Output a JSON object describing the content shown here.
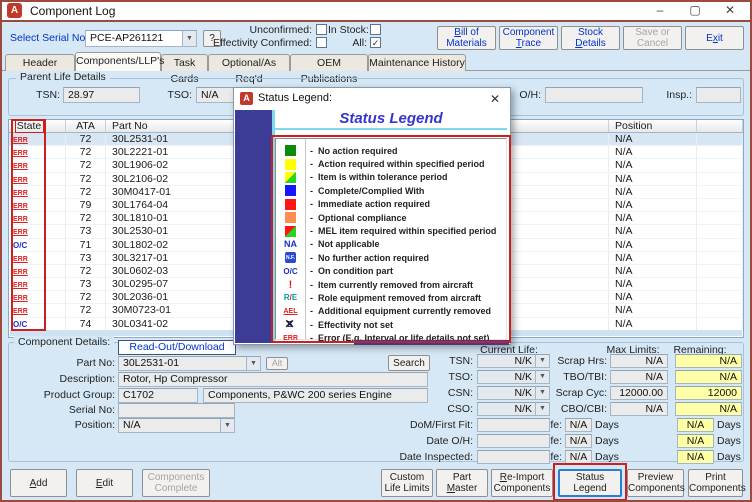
{
  "window": {
    "title": "Component Log",
    "app_icon_letter": "A",
    "controls": [
      {
        "name": "minimize",
        "glyph": "–"
      },
      {
        "name": "maximize",
        "glyph": "▢"
      },
      {
        "name": "close",
        "glyph": "✕"
      }
    ]
  },
  "header": {
    "serial_label": "Select Serial No:",
    "serial_value": "PCE-AP261121",
    "help_label": "?",
    "checkboxes": [
      {
        "label": "Unconfirmed:",
        "checked": false
      },
      {
        "label": "Effectivity Confirmed:",
        "checked": false
      },
      {
        "label": "In Stock:",
        "checked": false
      },
      {
        "label": "All:",
        "checked": true
      }
    ],
    "buttons": [
      {
        "lines": [
          "Bill of",
          "Materials"
        ],
        "accel": "B",
        "disabled": false
      },
      {
        "lines": [
          "Component",
          "Trace"
        ],
        "accel": "T",
        "disabled": false
      },
      {
        "lines": [
          "Stock",
          "Details"
        ],
        "accel": "D",
        "disabled": false
      },
      {
        "lines": [
          "Save or",
          "Cancel"
        ],
        "accel": null,
        "disabled": true
      },
      {
        "lines": [
          "Exit"
        ],
        "accel": "x",
        "disabled": false
      }
    ]
  },
  "tabs": [
    {
      "label": "Header Details",
      "active": false
    },
    {
      "label": "Components/LLP's",
      "active": true
    },
    {
      "label": "Task Cards",
      "active": false
    },
    {
      "label": "Optional/As Req'd",
      "active": false
    },
    {
      "label": "OEM Publications",
      "active": false
    },
    {
      "label": "Maintenance History",
      "active": false
    }
  ],
  "parent_life": {
    "title": "Parent Life Details",
    "fields": [
      {
        "label": "TSN:",
        "value": "28.97"
      },
      {
        "label": "TSO:",
        "value": "N/A"
      },
      {
        "label": "O/H:",
        "value": ""
      },
      {
        "label": "Insp.:",
        "value": ""
      }
    ]
  },
  "table": {
    "columns": [
      "State",
      "",
      "ATA",
      "Part No",
      "Position",
      ""
    ],
    "rows": [
      {
        "state": "ERR",
        "ata": "72",
        "part_no": "30L2531-01",
        "position": "N/A",
        "selected": true
      },
      {
        "state": "ERR",
        "ata": "72",
        "part_no": "30L2221-01",
        "position": "N/A",
        "selected": false
      },
      {
        "state": "ERR",
        "ata": "72",
        "part_no": "30L1906-02",
        "position": "N/A",
        "selected": false
      },
      {
        "state": "ERR",
        "ata": "72",
        "part_no": "30L2106-02",
        "position": "N/A",
        "selected": false
      },
      {
        "state": "ERR",
        "ata": "72",
        "part_no": "30M0417-01",
        "position": "N/A",
        "selected": false
      },
      {
        "state": "ERR",
        "ata": "79",
        "part_no": "30L1764-04",
        "position": "N/A",
        "selected": false
      },
      {
        "state": "ERR",
        "ata": "72",
        "part_no": "30L1810-01",
        "position": "N/A",
        "selected": false
      },
      {
        "state": "ERR",
        "ata": "73",
        "part_no": "30L2530-01",
        "position": "N/A",
        "selected": false
      },
      {
        "state": "O/C",
        "ata": "71",
        "part_no": "30L1802-02",
        "position": "N/A",
        "selected": false
      },
      {
        "state": "ERR",
        "ata": "73",
        "part_no": "30L3217-01",
        "position": "N/A",
        "selected": false
      },
      {
        "state": "ERR",
        "ata": "72",
        "part_no": "30L0602-03",
        "position": "N/A",
        "selected": false
      },
      {
        "state": "ERR",
        "ata": "73",
        "part_no": "30L0295-07",
        "position": "N/A",
        "selected": false
      },
      {
        "state": "ERR",
        "ata": "72",
        "part_no": "30L2036-01",
        "position": "N/A",
        "selected": false
      },
      {
        "state": "ERR",
        "ata": "72",
        "part_no": "30M0723-01",
        "position": "N/A",
        "selected": false
      },
      {
        "state": "O/C",
        "ata": "74",
        "part_no": "30L0341-02",
        "position": "N/A",
        "selected": false
      }
    ]
  },
  "status_dialog": {
    "title": "Status Legend:",
    "heading": "Status Legend",
    "app_icon_letter": "A",
    "close_glyph": "✕",
    "entries": [
      {
        "icon": "green-swatch",
        "label": "No action required"
      },
      {
        "icon": "yellow-swatch",
        "label": "Action required within specified period"
      },
      {
        "icon": "tolerance-swatch",
        "label": "Item is within tolerance period"
      },
      {
        "icon": "blue-swatch",
        "label": "Complete/Complied With"
      },
      {
        "icon": "red-swatch",
        "label": "Immediate action required"
      },
      {
        "icon": "orange-swatch",
        "label": "Optional compliance"
      },
      {
        "icon": "mel-swatch",
        "label": "MEL item required within specified period"
      },
      {
        "icon": "na-badge",
        "label": "Not applicable"
      },
      {
        "icon": "nf-badge",
        "label": "No further action required"
      },
      {
        "icon": "oc-badge",
        "label": "On condition part"
      },
      {
        "icon": "removed-badge",
        "label": "Item currently removed from aircraft"
      },
      {
        "icon": "role-equipment-badge",
        "label": "Role equipment removed from aircraft"
      },
      {
        "icon": "ael-badge",
        "label": "Additional equipment currently removed"
      },
      {
        "icon": "effectivity-not-set-badge",
        "label": "Effectivity not set"
      },
      {
        "icon": "error-badge",
        "label": "Error (E.g. Interval or life details not set)"
      }
    ]
  },
  "details": {
    "section_label": "Component Details:",
    "readout_label": "Read-Out/Download",
    "part_no": {
      "label": "Part No:",
      "value": "30L2531-01",
      "alt_label": "Alt",
      "search_label": "Search"
    },
    "description": {
      "label": "Description:",
      "value": "Rotor, Hp Compressor"
    },
    "product_group": {
      "label": "Product Group:",
      "code": "C1702",
      "name": "Components, P&WC 200 series Engine"
    },
    "serial_no": {
      "label": "Serial No:",
      "value": ""
    },
    "position": {
      "label": "Position:",
      "value": "N/A"
    },
    "dates": [
      {
        "label": "DoM/First Fit:",
        "value": ""
      },
      {
        "label": "Date O/H:",
        "value": ""
      },
      {
        "label": "Date Inspected:",
        "value": ""
      }
    ]
  },
  "life": {
    "current_header": "Current Life:",
    "max_header": "Max Limits:",
    "remaining_header": "Remaining:",
    "current_rows": [
      {
        "label": "TSN:",
        "value": "N/K"
      },
      {
        "label": "TSO:",
        "value": "N/K"
      },
      {
        "label": "CSN:",
        "value": "N/K"
      },
      {
        "label": "CSO:",
        "value": "N/K"
      }
    ],
    "limit_rows": [
      {
        "label": "Scrap Hrs:",
        "max": "N/A",
        "remaining": "N/A"
      },
      {
        "label": "TBO/TBI:",
        "max": "N/A",
        "remaining": "N/A"
      },
      {
        "label": "Scrap Cyc:",
        "max": "12000.00",
        "remaining": "12000"
      },
      {
        "label": "CBO/CBI:",
        "max": "N/A",
        "remaining": "N/A"
      }
    ],
    "day_rows": [
      {
        "label": "Scrap Life:",
        "max": "N/A",
        "remaining": "N/A",
        "unit": "Days"
      },
      {
        "label": "O/H Life:",
        "max": "N/A",
        "remaining": "N/A",
        "unit": "Days"
      },
      {
        "label": "Insp. Life:",
        "max": "N/A",
        "remaining": "N/A",
        "unit": "Days"
      }
    ]
  },
  "footer": {
    "buttons": [
      {
        "lines": [
          "Add"
        ],
        "accel": "A",
        "disabled": false,
        "highlighted": false
      },
      {
        "lines": [
          "Edit"
        ],
        "accel": "E",
        "disabled": false,
        "highlighted": false
      },
      {
        "lines": [
          "Components",
          "Complete"
        ],
        "accel": null,
        "disabled": true,
        "highlighted": false
      },
      {
        "lines": [
          "Custom",
          "Life Limits"
        ],
        "accel": null,
        "disabled": false,
        "highlighted": false
      },
      {
        "lines": [
          "Part",
          "Master"
        ],
        "accel": "M",
        "disabled": false,
        "highlighted": false
      },
      {
        "lines": [
          "Re-Import",
          "Components"
        ],
        "accel": "R",
        "disabled": false,
        "highlighted": false
      },
      {
        "lines": [
          "Status",
          "Legend"
        ],
        "accel": null,
        "disabled": false,
        "highlighted": true
      },
      {
        "lines": [
          "Preview",
          "Components"
        ],
        "accel": null,
        "disabled": false,
        "highlighted": false
      },
      {
        "lines": [
          "Print",
          "Components"
        ],
        "accel": null,
        "disabled": false,
        "highlighted": false
      }
    ]
  },
  "colors": {
    "window_border": "#9b4a40",
    "accent_blue": "#0033cc",
    "annotation_red": "#cc2020",
    "remaining_yellow": "#ffffa6",
    "dialog_band_navy": "#3c3c96",
    "dialog_cyan": "#7fd9ec",
    "legend_title_blue": "#3535cf",
    "error_red": "#e02020",
    "status_blue": "#2030c0"
  }
}
